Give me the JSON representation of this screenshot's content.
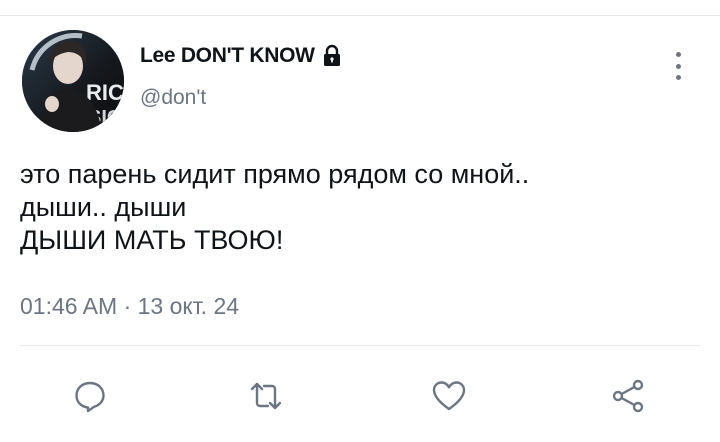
{
  "author": {
    "display_name": "Lee DON'T KNOW",
    "handle": "@don't",
    "protected_icon": "lock-icon",
    "avatar_text": "RICA",
    "avatar_text_line2": "SIC"
  },
  "tweet": {
    "lines": [
      "это парень сидит прямо рядом со мной..",
      "дыши.. дыши",
      "ДЫШИ МАТЬ ТВОЮ!"
    ],
    "timestamp": "01:46 AM · 13 окт. 24"
  },
  "actions": [
    {
      "name": "reply",
      "icon": "speech-bubble-icon"
    },
    {
      "name": "retweet",
      "icon": "retweet-icon"
    },
    {
      "name": "like",
      "icon": "heart-icon"
    },
    {
      "name": "share",
      "icon": "share-icon"
    }
  ],
  "colors": {
    "text": "#0f1419",
    "secondary": "#6b7682",
    "divider": "#e6e8ea"
  }
}
